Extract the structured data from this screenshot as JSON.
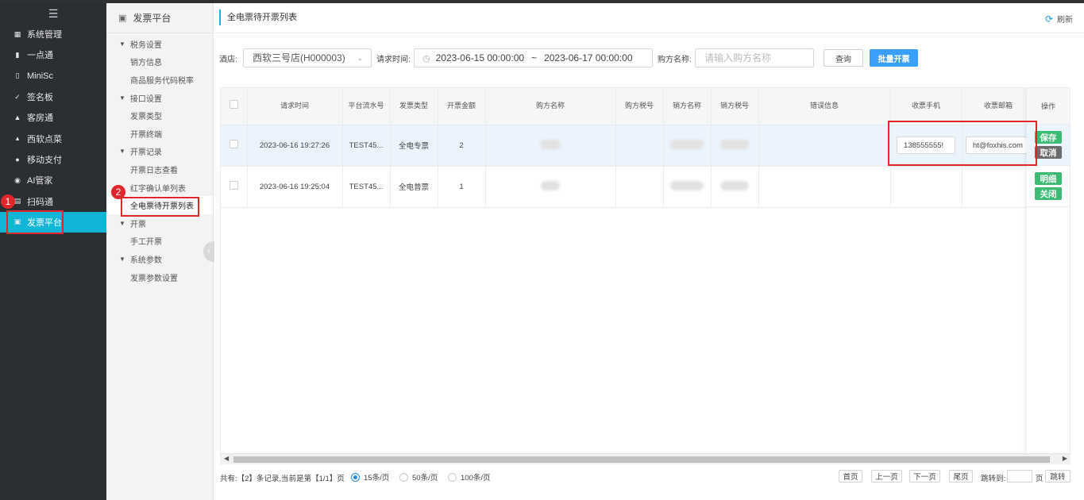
{
  "nav": {
    "items": [
      {
        "label": "系统管理",
        "icon": "grid-icon"
      },
      {
        "label": "一点通",
        "icon": "bar-chart-icon"
      },
      {
        "label": "MiniSc",
        "icon": "bar-icon"
      },
      {
        "label": "签名板",
        "icon": "pen-icon"
      },
      {
        "label": "客房通",
        "icon": "home-icon"
      },
      {
        "label": "西软点菜",
        "icon": "triangle-icon"
      },
      {
        "label": "移动支付",
        "icon": "circle-icon"
      },
      {
        "label": "AI管家",
        "icon": "robot-icon"
      },
      {
        "label": "扫码通",
        "icon": "scan-icon"
      },
      {
        "label": "发票平台",
        "icon": "invoice-icon"
      }
    ]
  },
  "submenu": {
    "title": "发票平台",
    "tree": [
      {
        "type": "group",
        "label": "税务设置"
      },
      {
        "type": "item",
        "label": "销方信息"
      },
      {
        "type": "item",
        "label": "商品服务代码税率"
      },
      {
        "type": "group",
        "label": "接口设置"
      },
      {
        "type": "item",
        "label": "发票类型"
      },
      {
        "type": "item",
        "label": "开票终端"
      },
      {
        "type": "group",
        "label": "开票记录"
      },
      {
        "type": "item",
        "label": "开票日志查看"
      },
      {
        "type": "item",
        "label": "红字确认单列表"
      },
      {
        "type": "item",
        "label": "全电票待开票列表"
      },
      {
        "type": "group",
        "label": "开票"
      },
      {
        "type": "item",
        "label": "手工开票"
      },
      {
        "type": "group",
        "label": "系统参数"
      },
      {
        "type": "item",
        "label": "发票参数设置"
      }
    ]
  },
  "annotations": {
    "badge1": "1",
    "badge2": "2"
  },
  "page": {
    "title": "全电票待开票列表",
    "refresh": "刷新"
  },
  "filters": {
    "hotel_label": "酒店:",
    "hotel_value": "西软三号店(H000003)",
    "time_label": "请求时间:",
    "date_from": "2023-06-15 00:00:00",
    "date_sep": "~",
    "date_to": "2023-06-17 00:00:00",
    "buyer_label": "购方名称:",
    "buyer_placeholder": "请输入购方名称",
    "query": "查询",
    "batch": "批量开票"
  },
  "table": {
    "headers": [
      "请求时间",
      "平台流水号",
      "发票类型",
      "开票金额",
      "购方名称",
      "购方税号",
      "销方名称",
      "销方税号",
      "错误信息",
      "收票手机",
      "收票邮箱",
      "操作"
    ],
    "rows": [
      {
        "time": "2023-06-16 19:27:26",
        "serial": "TEST45...",
        "type": "全电专票",
        "amount": "2",
        "phone": "138555555!",
        "email": "ht@foxhis.com",
        "actions": [
          "保存",
          "取消"
        ]
      },
      {
        "time": "2023-06-16 19:25:04",
        "serial": "TEST45...",
        "type": "全电普票",
        "amount": "1",
        "phone": "",
        "email": "",
        "actions": [
          "明细",
          "关闭"
        ]
      }
    ]
  },
  "footer": {
    "total": "共有:【2】条记录,当前是第【1/1】页",
    "page_sizes": [
      "15条/页",
      "50条/页",
      "100条/页"
    ],
    "selected_size": "15条/页",
    "first": "首页",
    "prev": "上一页",
    "next": "下一页",
    "last": "尾页",
    "jump_label": "跳转到:",
    "page_unit": "页",
    "jump": "跳转"
  },
  "colors": {
    "accent": "#12b5d6",
    "primary_button": "#3a9efc",
    "annotation": "#e0262b",
    "success": "#3dbb74"
  }
}
